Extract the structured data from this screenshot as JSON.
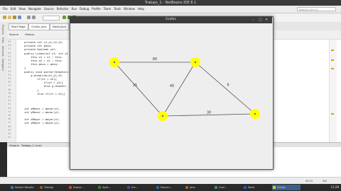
{
  "ide": {
    "title": "Trabajo_1 - NetBeans IDE 8.1",
    "menu": [
      "File",
      "Edit",
      "View",
      "Navigate",
      "Source",
      "Refactor",
      "Run",
      "Debug",
      "Profile",
      "Team",
      "Tools",
      "Window",
      "Help"
    ],
    "search_placeholder": "Search (Ctrl+I)",
    "editor_tabs": [
      "Start Page",
      "Grafos.java",
      "Nodo.java"
    ],
    "sub_tabs": [
      "Source",
      "History"
    ],
    "sidebar": [
      "Projects",
      "Files",
      "Services",
      "Navigator"
    ],
    "line_numbers": [
      "25",
      "26",
      "27",
      "28",
      "29",
      "30",
      "31",
      "32",
      "33",
      "34",
      "35",
      "36",
      "37",
      "38",
      "39",
      "40",
      "41",
      "42",
      "43",
      "44",
      "45",
      "46",
      "47",
      "48",
      "49",
      "50",
      "51"
    ],
    "code_lines": [
      "    private int x1,y1,x2,y2;",
      "    private int peso;",
      "    private boolean sel;",
      "    public Linea(int x1, int y1",
      "        this.x1 = x1 ; this.",
      "        this.x2 = x2 ; this.",
      "        this.peso = peso;",
      "    }",
      "    public void pintar(Graphics",
      "        g.drawLine(x1,y1,x2,",
      "            if(x1 < x2){",
      "                if(y1 > y2){",
      "                else g.drawStr",
      "            }",
      "            else if(x1 > x2){",
      "",
      "",
      "",
      "    int xMenor = menor(x1,",
      "    int yMenor = menor(y1,",
      "",
      "    int xMayor = mayor(x1,",
      "    int yMayor = mayor(y1,"
    ],
    "output_tab": "Output - Trabajo_1 (run)",
    "status_right": "INS",
    "status_pos": "40:43"
  },
  "taskbar": {
    "items": [
      "Search Results",
      "Trabajo",
      "Nuevo...",
      "Aplic...",
      "Arc...",
      "Docum...",
      "java",
      "Graf...",
      "Word",
      "Grafos"
    ],
    "active": "Grafos",
    "clock": "11:28"
  },
  "grafos": {
    "title": "Grafos",
    "nodes": [
      {
        "id": "A"
      },
      {
        "id": "B"
      },
      {
        "id": "C"
      },
      {
        "id": "D"
      }
    ],
    "edges": [
      {
        "from": "A",
        "to": "B",
        "label": "80"
      },
      {
        "from": "A",
        "to": "C",
        "label": "25"
      },
      {
        "from": "B",
        "to": "C",
        "label": "45"
      },
      {
        "from": "B",
        "to": "D",
        "label": "9"
      },
      {
        "from": "C",
        "to": "D",
        "label": "30"
      }
    ],
    "node_color": "#ffff00",
    "edge_color": "#555555"
  },
  "colors": {
    "ide_bg": "#ececec",
    "taskbar_bg": "#2a2a2a",
    "window_title": "#3c3c3c",
    "keyword": "#0000b0"
  }
}
